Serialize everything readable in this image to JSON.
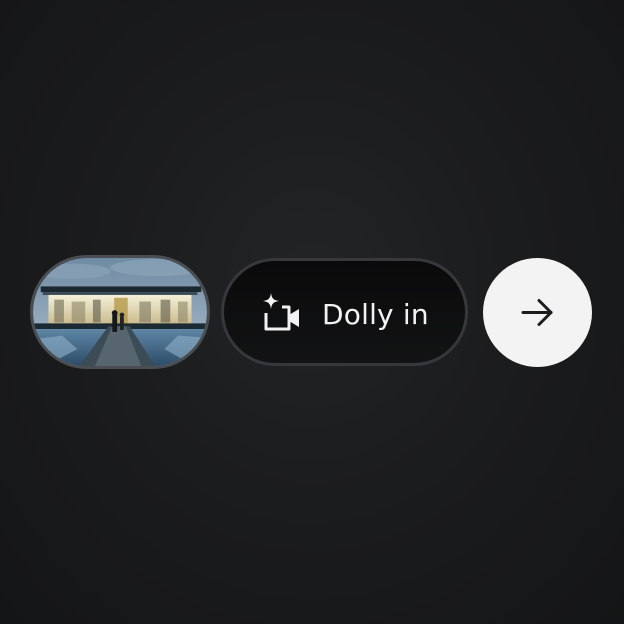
{
  "thumbnail": {
    "description_icon": "image-thumbnail"
  },
  "prompt_button": {
    "label": "Dolly in",
    "icon": "camera-sparkle-icon"
  },
  "next_button": {
    "icon": "arrow-right-icon"
  },
  "colors": {
    "background": "#1b1c1e",
    "pill_bg": "#0e0e0f",
    "pill_border": "#36383b",
    "next_bg": "#f3f3f4",
    "text": "#f2f2f2"
  }
}
